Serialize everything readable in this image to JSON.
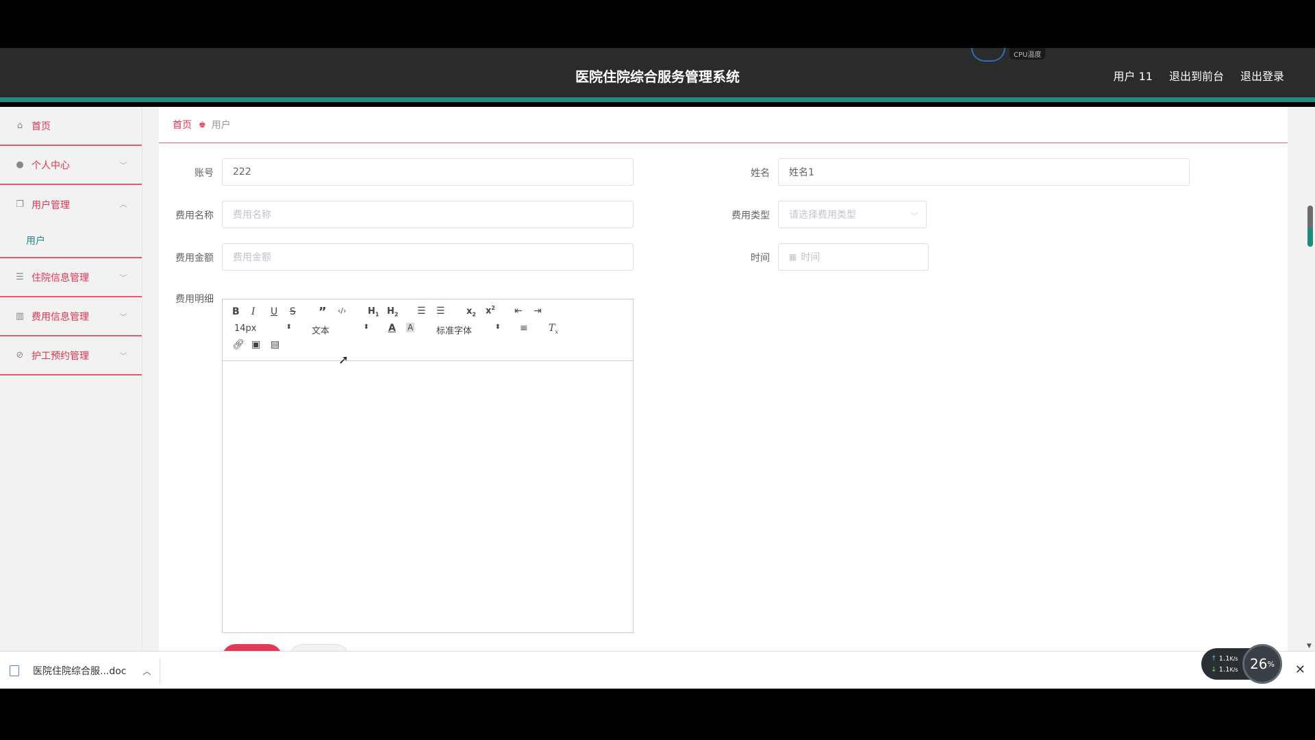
{
  "header": {
    "title": "医院住院综合服务管理系统",
    "cpu_label": "CPU温度",
    "user": "用户 11",
    "to_front": "退出到前台",
    "logout": "退出登录"
  },
  "sidebar": {
    "items": [
      {
        "label": "首页",
        "icon": "home-icon"
      },
      {
        "label": "个人中心",
        "icon": "person-icon"
      },
      {
        "label": "用户管理",
        "icon": "copy-icon"
      },
      {
        "label": "住院信息管理",
        "icon": "list-icon"
      },
      {
        "label": "费用信息管理",
        "icon": "chart-icon"
      },
      {
        "label": "护工预约管理",
        "icon": "bell-off-icon"
      }
    ],
    "submenu": [
      "用户"
    ]
  },
  "breadcrumb": {
    "home": "首页",
    "current": "用户"
  },
  "form": {
    "account_label": "账号",
    "account_value": "222",
    "name_label": "姓名",
    "name_value": "姓名1",
    "fee_name_label": "费用名称",
    "fee_name_placeholder": "费用名称",
    "fee_type_label": "费用类型",
    "fee_type_placeholder": "请选择费用类型",
    "fee_amount_label": "费用金额",
    "fee_amount_placeholder": "费用金额",
    "time_label": "时间",
    "time_placeholder": "时间",
    "detail_label": "费用明细"
  },
  "editor": {
    "font_size": "14px",
    "header_select": "文本",
    "font_family": "标准字体"
  },
  "download_bar": {
    "filename": "医院住院综合服...doc"
  },
  "net_widget": {
    "up": "1.1",
    "down": "1.1",
    "unit": "K/s",
    "percent": "26",
    "percent_unit": "%"
  }
}
